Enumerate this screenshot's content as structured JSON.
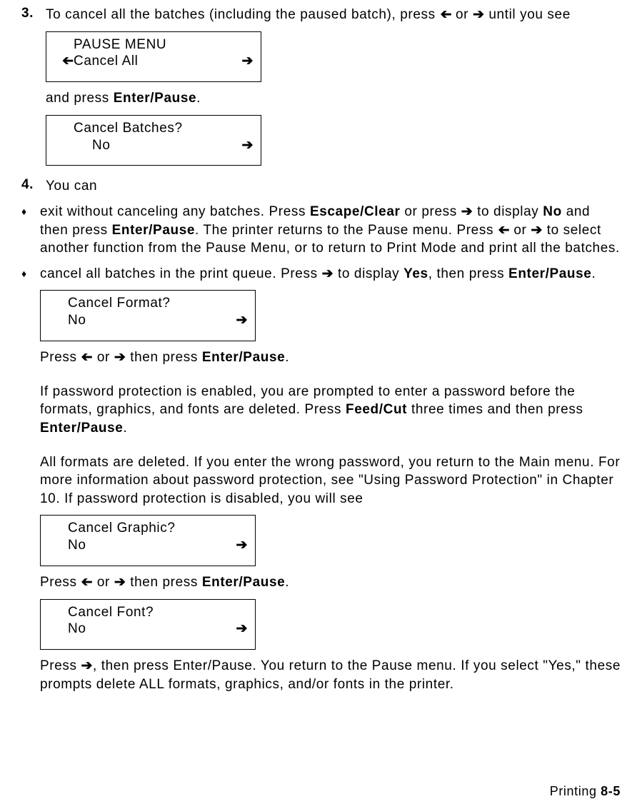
{
  "step3": {
    "num": "3.",
    "text_a": "To cancel all the batches (including the paused batch), press ",
    "text_b": " or ",
    "text_c": " until you see",
    "lcd1_line1": "PAUSE MENU",
    "lcd1_line2": "Cancel All",
    "and_press": "and press ",
    "enter_pause": "Enter/Pause",
    "period": ".",
    "lcd2_line1": "Cancel Batches?",
    "lcd2_line2": "No"
  },
  "step4": {
    "num": "4.",
    "text": "You can"
  },
  "bullet1": {
    "a": "exit without canceling any batches.  Press ",
    "escape_clear": "Escape/Clear",
    "b": " or press ",
    "c": " to display ",
    "no": "No",
    "d": " and then press ",
    "enter_pause": "Enter/Pause",
    "e": ".  The printer returns to the Pause menu.  Press ",
    "f": " or ",
    "g": " to select another function from the Pause Menu, or to return to Print Mode and print all the batches."
  },
  "bullet2": {
    "a": "cancel all batches in the print queue.  Press ",
    "b": " to display ",
    "yes": "Yes",
    "c": ", then press ",
    "enter_pause": "Enter/Pause",
    "d": ".",
    "lcd3_line1": "Cancel Format?",
    "lcd3_line2": "No",
    "press_text_a": "Press ",
    "press_text_b": " or ",
    "press_text_c": " then press ",
    "press_text_d": ".",
    "pwd_para1": "If password protection is enabled, you are prompted to enter a password before the formats, graphics, and fonts are deleted.  Press ",
    "feed_cut": "Feed/Cut",
    "pwd_para1b": " three times and then press ",
    "pwd_para2": "All formats are deleted.  If you enter the wrong password, you return to the Main menu.  For more information about password protection, see \"Using Password Protection\" in Chapter 10.  If password protection is disabled, you will see",
    "lcd4_line1": "Cancel Graphic?",
    "lcd4_line2": "No",
    "lcd5_line1": "Cancel Font?",
    "lcd5_line2": "No",
    "final_a": "Press ",
    "final_b": ", then press Enter/Pause.  You return to the Pause menu.  If you select \"Yes,\" these prompts delete ALL formats, graphics, and/or fonts in the printer."
  },
  "footer": {
    "label": "Printing  ",
    "page": "8-5"
  }
}
